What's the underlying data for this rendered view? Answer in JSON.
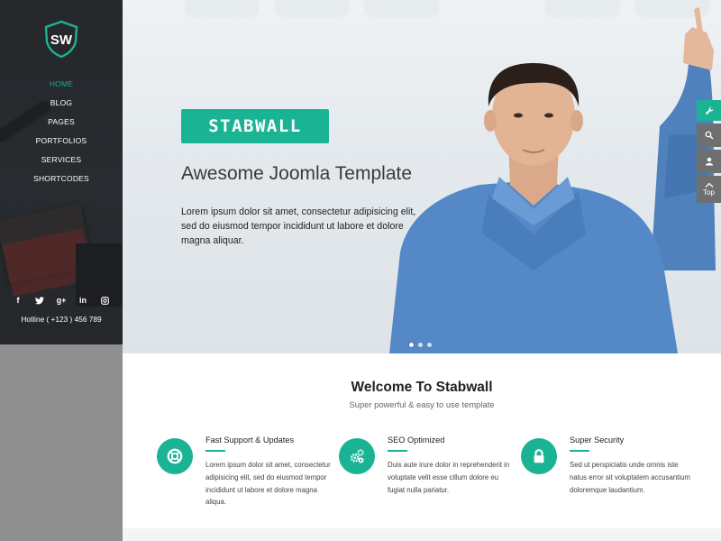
{
  "sidebar": {
    "logo_text": "SW",
    "nav": [
      {
        "label": "HOME",
        "active": true
      },
      {
        "label": "BLOG",
        "active": false
      },
      {
        "label": "PAGES",
        "active": false
      },
      {
        "label": "PORTFOLIOS",
        "active": false
      },
      {
        "label": "SERVICES",
        "active": false
      },
      {
        "label": "SHORTCODES",
        "active": false
      }
    ],
    "social": [
      {
        "icon": "facebook-icon",
        "glyph": "f"
      },
      {
        "icon": "twitter-icon",
        "glyph": "t"
      },
      {
        "icon": "google-plus-icon",
        "glyph": "g+"
      },
      {
        "icon": "linkedin-icon",
        "glyph": "in"
      },
      {
        "icon": "instagram-icon",
        "glyph": "◙"
      }
    ],
    "hotline": "Hotline ( +123 ) 456 789"
  },
  "hero": {
    "brand": "STABWALL",
    "title": "Awesome Joomla Template",
    "text": "Lorem ipsum dolor sit amet, consectetur adipisicing elit, sed do eiusmod tempor incididunt ut labore et dolore magna aliquar.",
    "slides": 3,
    "active_slide": 0
  },
  "tools": {
    "settings_icon": "wrench-icon",
    "search_icon": "search-icon",
    "user_icon": "user-icon",
    "top_label": "Top"
  },
  "welcome": {
    "title": "Welcome To Stabwall",
    "subtitle": "Super powerful & easy to use template",
    "features": [
      {
        "icon": "lifebuoy-icon",
        "title": "Fast Support & Updates",
        "text": "Lorem ipsum dolor sit amet, consectetur adipisicing elit, sed do eiusmod tempor incididunt ut labore et dolore magna aliqua."
      },
      {
        "icon": "gears-icon",
        "title": "SEO Optimized",
        "text": "Duis aute irure dolor in reprehenderit in voluptate velit esse cillum dolore eu fugiat nulla pariatur."
      },
      {
        "icon": "lock-icon",
        "title": "Super Security",
        "text": "Sed ut perspiciatis unde omnis iste natus error sit voluptatem accusantium doloremque laudantium."
      }
    ]
  },
  "colors": {
    "accent": "#1ab394",
    "sidebar_dark": "#2e3135",
    "sidebar_gray": "#8f8f8f",
    "tool_gray": "#6d6f71"
  }
}
